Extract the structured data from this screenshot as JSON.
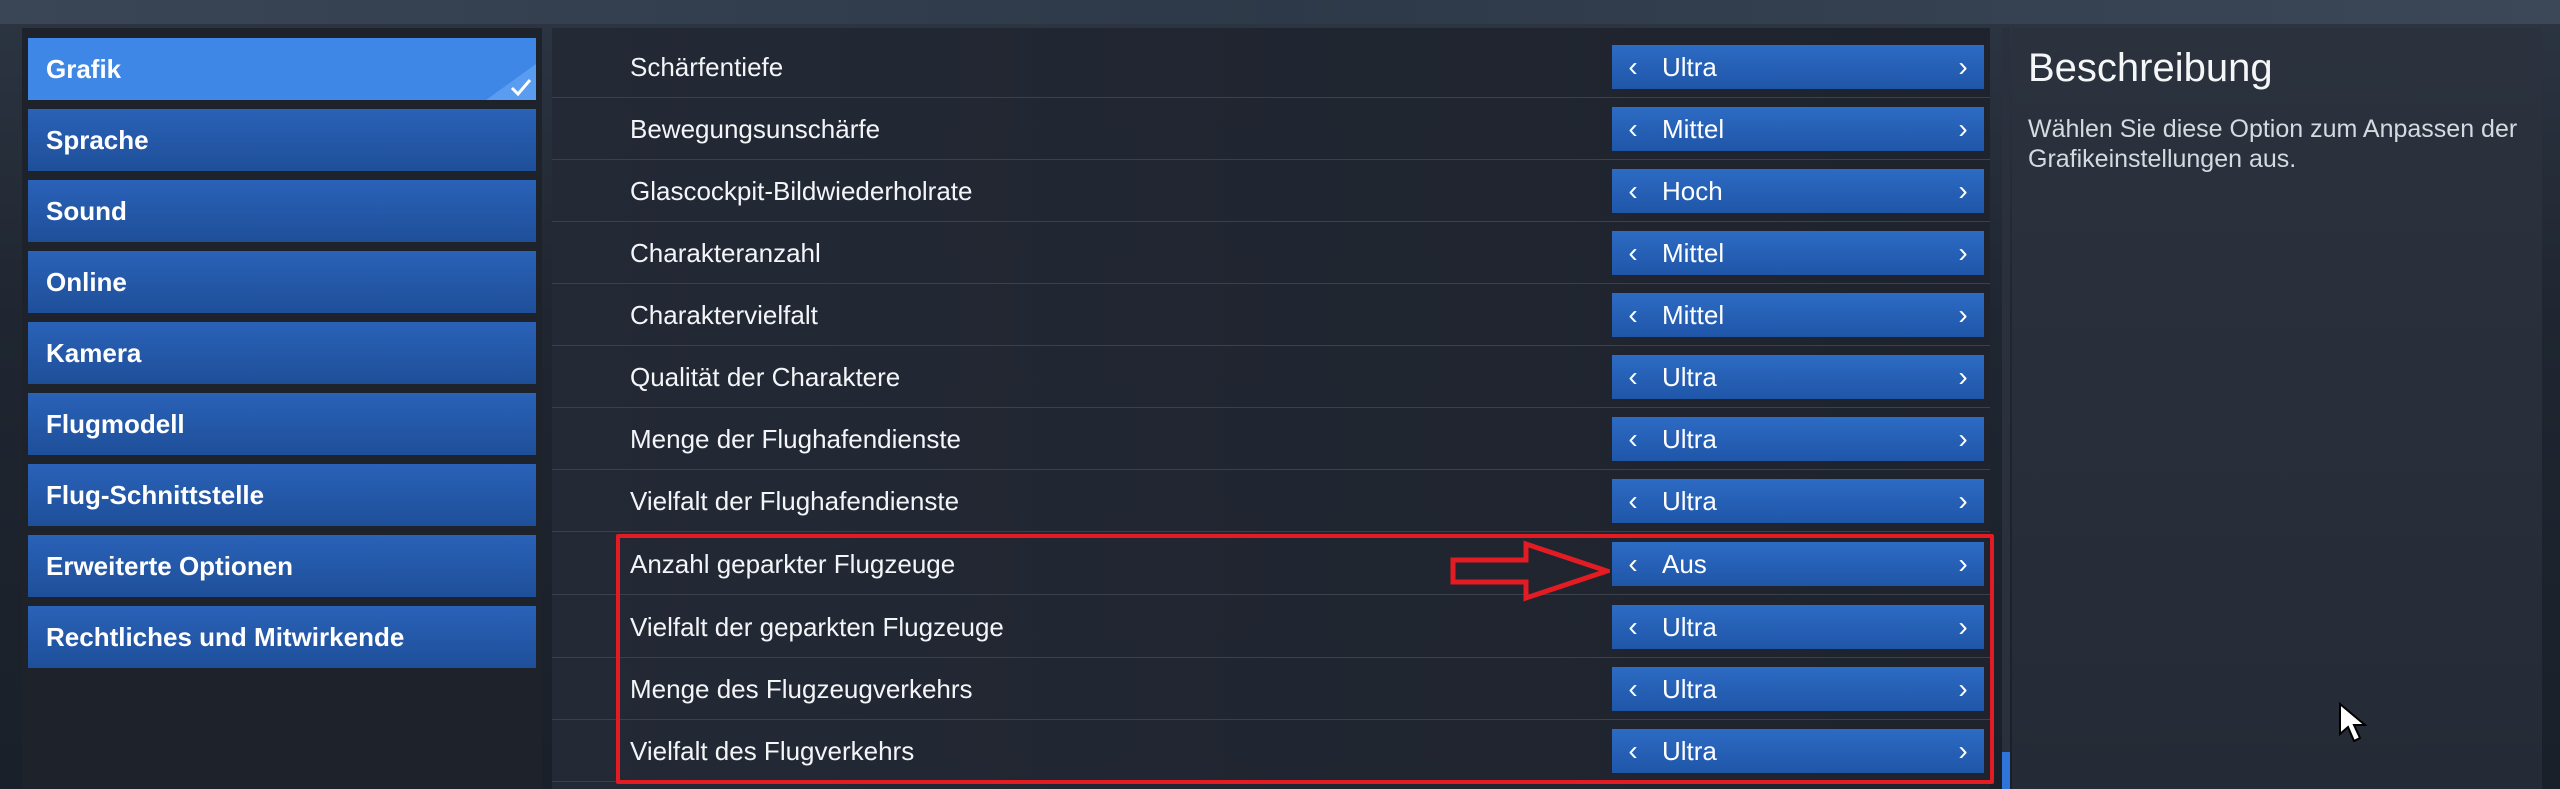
{
  "nav": {
    "items": [
      {
        "label": "Grafik",
        "active": true
      },
      {
        "label": "Sprache"
      },
      {
        "label": "Sound"
      },
      {
        "label": "Online"
      },
      {
        "label": "Kamera"
      },
      {
        "label": "Flugmodell"
      },
      {
        "label": "Flug-Schnittstelle"
      },
      {
        "label": "Erweiterte Optionen"
      },
      {
        "label": "Rechtliches und Mitwirkende"
      }
    ]
  },
  "settings": [
    {
      "label": "Schärfentiefe",
      "value": "Ultra"
    },
    {
      "label": "Bewegungsunschärfe",
      "value": "Mittel"
    },
    {
      "label": "Glascockpit-Bildwiederholrate",
      "value": "Hoch"
    },
    {
      "label": "Charakteranzahl",
      "value": "Mittel"
    },
    {
      "label": "Charaktervielfalt",
      "value": "Mittel"
    },
    {
      "label": "Qualität der Charaktere",
      "value": "Ultra"
    },
    {
      "label": "Menge der Flughafendienste",
      "value": "Ultra"
    },
    {
      "label": "Vielfalt der Flughafendienste",
      "value": "Ultra"
    },
    {
      "label": "Anzahl geparkter Flugzeuge",
      "value": "Aus"
    },
    {
      "label": "Vielfalt der geparkten Flugzeuge",
      "value": "Ultra"
    },
    {
      "label": "Menge des Flugzeugverkehrs",
      "value": "Ultra"
    },
    {
      "label": "Vielfalt des Flugverkehrs",
      "value": "Ultra"
    }
  ],
  "description": {
    "title": "Beschreibung",
    "text": "Wählen Sie diese Option zum Anpassen der Grafikeinstellungen aus."
  },
  "colors": {
    "accent_blue": "#2f74d8",
    "highlight_red": "#e31b23"
  },
  "icons": {
    "prev": "chevron-left-icon",
    "next": "chevron-right-icon",
    "active": "checkmark-icon",
    "annotation": "red-arrow-icon",
    "pointer": "mouse-cursor-icon"
  }
}
